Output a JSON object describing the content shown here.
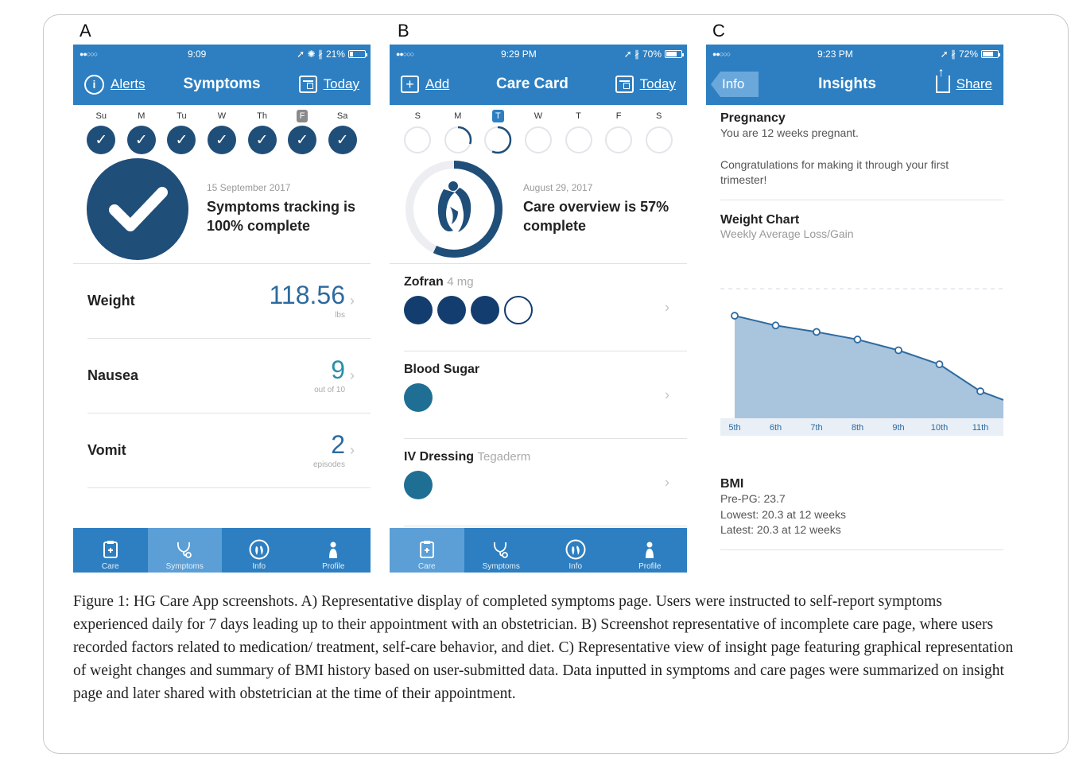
{
  "panels": {
    "a": {
      "letter": "A",
      "status": {
        "carrier": "●●○○○",
        "time": "9:09",
        "icons": "➚ ✺ ∦",
        "battery": "21%",
        "battery_level": 0.21
      },
      "nav": {
        "left_label": "Alerts",
        "title": "Symptoms",
        "right_label": "Today"
      },
      "week": [
        {
          "label": "Su",
          "state": "done"
        },
        {
          "label": "M",
          "state": "done"
        },
        {
          "label": "Tu",
          "state": "done"
        },
        {
          "label": "W",
          "state": "done"
        },
        {
          "label": "Th",
          "state": "done"
        },
        {
          "label": "F",
          "state": "done",
          "highlight": "gray"
        },
        {
          "label": "Sa",
          "state": "done"
        }
      ],
      "summary": {
        "date": "15 September 2017",
        "text": "Symptoms tracking is 100% complete",
        "progress": 1.0
      },
      "rows": [
        {
          "label": "Weight",
          "value": "118.56",
          "unit": "lbs",
          "value_color": "#2d6a9f"
        },
        {
          "label": "Nausea",
          "value": "9",
          "unit": "out of 10",
          "value_color": "#2a8fa8"
        },
        {
          "label": "Vomit",
          "value": "2",
          "unit": "episodes",
          "value_color": "#2d6a9f"
        }
      ],
      "tabs": [
        {
          "label": "Care",
          "icon": "clipboard-icon",
          "active": false
        },
        {
          "label": "Symptoms",
          "icon": "stethoscope-icon",
          "active": true
        },
        {
          "label": "Info",
          "icon": "pregnancy-icon",
          "active": false
        },
        {
          "label": "Profile",
          "icon": "profile-icon",
          "active": false
        }
      ]
    },
    "b": {
      "letter": "B",
      "status": {
        "carrier": "●●○○○",
        "time": "9:29 PM",
        "icons": "➚ ∦",
        "battery": "70%",
        "battery_level": 0.7
      },
      "nav": {
        "left_label": "Add",
        "title": "Care Card",
        "right_label": "Today"
      },
      "week": [
        {
          "label": "S",
          "progress": 0
        },
        {
          "label": "M",
          "progress": 0.3
        },
        {
          "label": "T",
          "progress": 0.57,
          "highlight": "blue"
        },
        {
          "label": "W",
          "progress": 0
        },
        {
          "label": "T",
          "progress": 0
        },
        {
          "label": "F",
          "progress": 0
        },
        {
          "label": "S",
          "progress": 0
        }
      ],
      "summary": {
        "date": "August 29, 2017",
        "text": "Care overview is 57% complete",
        "progress": 0.57
      },
      "items": [
        {
          "title": "Zofran",
          "subtitle": "4 mg",
          "dots": [
            "navy",
            "navy",
            "navy",
            "empty"
          ]
        },
        {
          "title": "Blood Sugar",
          "subtitle": "",
          "dots": [
            "teal"
          ]
        },
        {
          "title": "IV Dressing",
          "subtitle": "Tegaderm",
          "dots": [
            "teal"
          ]
        }
      ],
      "tabs": [
        {
          "label": "Care",
          "icon": "clipboard-icon",
          "active": true
        },
        {
          "label": "Symptoms",
          "icon": "stethoscope-icon",
          "active": false
        },
        {
          "label": "Info",
          "icon": "pregnancy-icon",
          "active": false
        },
        {
          "label": "Profile",
          "icon": "profile-icon",
          "active": false
        }
      ]
    },
    "c": {
      "letter": "C",
      "status": {
        "carrier": "●●○○○",
        "time": "9:23 PM",
        "icons": "➚ ∦",
        "battery": "72%",
        "battery_level": 0.72
      },
      "nav": {
        "left_label": "Info",
        "title": "Insights",
        "right_label": "Share"
      },
      "pregnancy": {
        "title": "Pregnancy",
        "line1": "You are 12 weeks pregnant.",
        "line2": "Congratulations for making it through your first trimester!"
      },
      "weight_chart": {
        "title": "Weight Chart",
        "subtitle": "Weekly Average Loss/Gain"
      },
      "bmi": {
        "title": "BMI",
        "pre": "Pre-PG: 23.7",
        "lowest": "Lowest:  20.3 at 12 weeks",
        "latest": "Latest:  20.3 at 12 weeks"
      }
    }
  },
  "chart_data": {
    "type": "area",
    "title": "Weight Chart",
    "subtitle": "Weekly Average Loss/Gain",
    "categories": [
      "5th",
      "6th",
      "7th",
      "8th",
      "9th",
      "10th",
      "11th"
    ],
    "values": [
      9.5,
      8.6,
      8.0,
      7.3,
      6.3,
      5.0,
      2.5
    ],
    "ylim": [
      0,
      14
    ],
    "fill_color": "#a9c4dd",
    "line_color": "#2d6a9f"
  },
  "caption": {
    "p1": "Figure 1: HG Care App screenshots. A) Representative display of completed symptoms page. Users were instructed to self-report symptoms experienced daily for 7 days leading up to their appointment with an obstetrician. B) Screenshot representative of incomplete care page, where users recorded factors related to medication/ treatment, self-care behavior, and diet. C) Representative view of insight page featuring graphical representation of weight changes and summary of BMI history based on user-submitted data. Data inputted in symptoms and care pages were summarized on insight page and later shared with obstetrician at the time of their appointment."
  }
}
